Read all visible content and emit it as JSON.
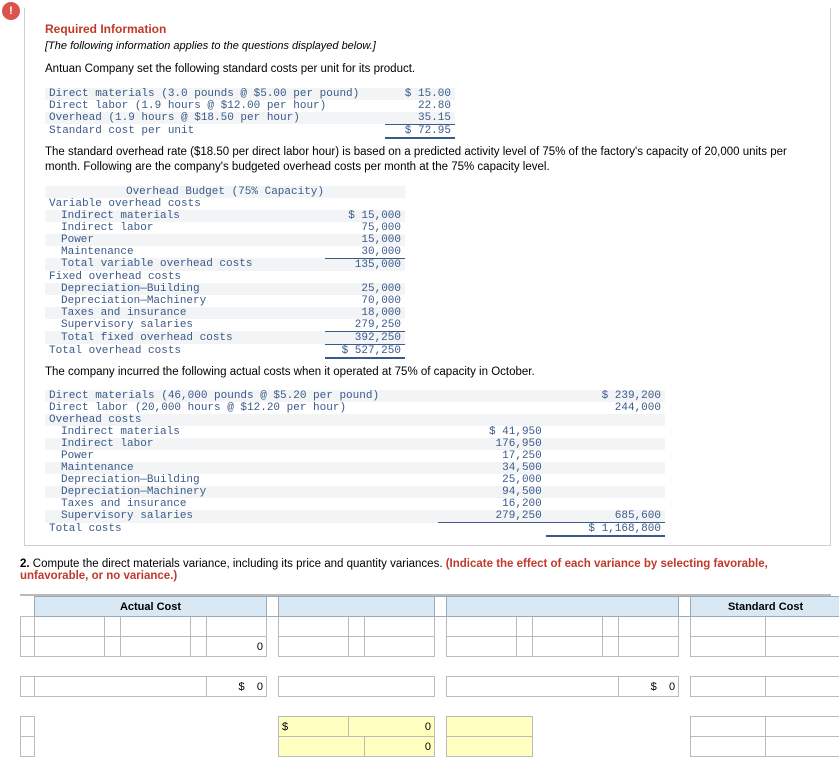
{
  "alert_glyph": "!",
  "header": {
    "title": "Required Information",
    "note": "[The following information applies to the questions displayed below.]",
    "intro": "Antuan Company set the following standard costs per unit for its product."
  },
  "std_costs": {
    "r1": {
      "label": "Direct materials (3.0 pounds @ $5.00 per pound)",
      "amt": "$ 15.00"
    },
    "r2": {
      "label": "Direct labor (1.9 hours @ $12.00 per hour)",
      "amt": "22.80"
    },
    "r3": {
      "label": "Overhead (1.9 hours @ $18.50 per hour)",
      "amt": "35.15"
    },
    "r4": {
      "label": "Standard cost per unit",
      "amt": "$ 72.95"
    }
  },
  "para1": "The standard overhead rate ($18.50 per direct labor hour) is based on a predicted activity level of 75% of the factory's capacity of 20,000 units per month. Following are the company's budgeted overhead costs per month at the 75% capacity level.",
  "budget": {
    "title": "Overhead Budget (75% Capacity)",
    "vh": "Variable overhead costs",
    "v1": {
      "l": "Indirect materials",
      "a": "$ 15,000"
    },
    "v2": {
      "l": "Indirect labor",
      "a": "75,000"
    },
    "v3": {
      "l": "Power",
      "a": "15,000"
    },
    "v4": {
      "l": "Maintenance",
      "a": "30,000"
    },
    "vt": {
      "l": "Total variable overhead costs",
      "a": "135,000"
    },
    "fh": "Fixed overhead costs",
    "f1": {
      "l": "Depreciation—Building",
      "a": "25,000"
    },
    "f2": {
      "l": "Depreciation—Machinery",
      "a": "70,000"
    },
    "f3": {
      "l": "Taxes and insurance",
      "a": "18,000"
    },
    "f4": {
      "l": "Supervisory salaries",
      "a": "279,250"
    },
    "ft": {
      "l": "Total fixed overhead costs",
      "a": "392,250"
    },
    "gt": {
      "l": "Total overhead costs",
      "a": "$ 527,250"
    }
  },
  "para2": "The company incurred the following actual costs when it operated at 75% of capacity in October.",
  "actual": {
    "r1": {
      "l": "Direct materials (46,000 pounds @ $5.20 per pound)",
      "a": "$ 239,200"
    },
    "r2": {
      "l": "Direct labor (20,000 hours @ $12.20 per hour)",
      "a": "244,000"
    },
    "oh": "Overhead costs",
    "o1": {
      "l": "Indirect materials",
      "a": "$ 41,950"
    },
    "o2": {
      "l": "Indirect labor",
      "a": "176,950"
    },
    "o3": {
      "l": "Power",
      "a": "17,250"
    },
    "o4": {
      "l": "Maintenance",
      "a": "34,500"
    },
    "o5": {
      "l": "Depreciation—Building",
      "a": "25,000"
    },
    "o6": {
      "l": "Depreciation—Machinery",
      "a": "94,500"
    },
    "o7": {
      "l": "Taxes and insurance",
      "a": "16,200"
    },
    "o8": {
      "l": "Supervisory salaries",
      "a": "279,250"
    },
    "ot": "685,600",
    "tc": {
      "l": "Total costs",
      "a": "$ 1,168,800"
    }
  },
  "question": {
    "num": "2.",
    "text": " Compute the direct materials variance, including its price and quantity variances. ",
    "hint": "(Indicate the effect of each variance by selecting favorable, unfavorable, or no variance.)"
  },
  "sheet": {
    "h_actual": "Actual Cost",
    "h_standard": "Standard Cost",
    "zero": "0",
    "dollar": "$",
    "dz": "0"
  }
}
